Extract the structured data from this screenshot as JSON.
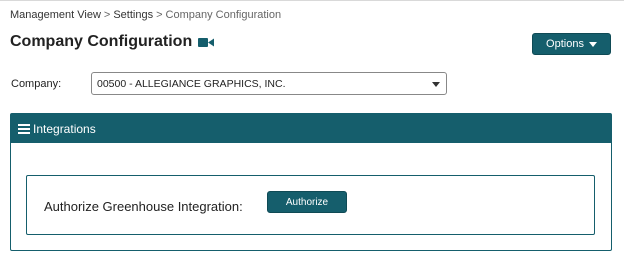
{
  "breadcrumb": {
    "items": [
      "Management View",
      "Settings",
      "Company Configuration"
    ],
    "separator": ">"
  },
  "page": {
    "title": "Company Configuration",
    "title_icon": "video-camera-icon"
  },
  "header": {
    "options_label": "Options",
    "options_icon": "caret-down-icon"
  },
  "company": {
    "label": "Company:",
    "selected": "00500 - ALLEGIANCE GRAPHICS, INC."
  },
  "panel": {
    "title": "Integrations",
    "icon": "hamburger-icon",
    "authorize_label": "Authorize Greenhouse Integration:",
    "authorize_button": "Authorize"
  },
  "colors": {
    "primary": "#155e6c",
    "text": "#222222",
    "muted": "#666666"
  }
}
